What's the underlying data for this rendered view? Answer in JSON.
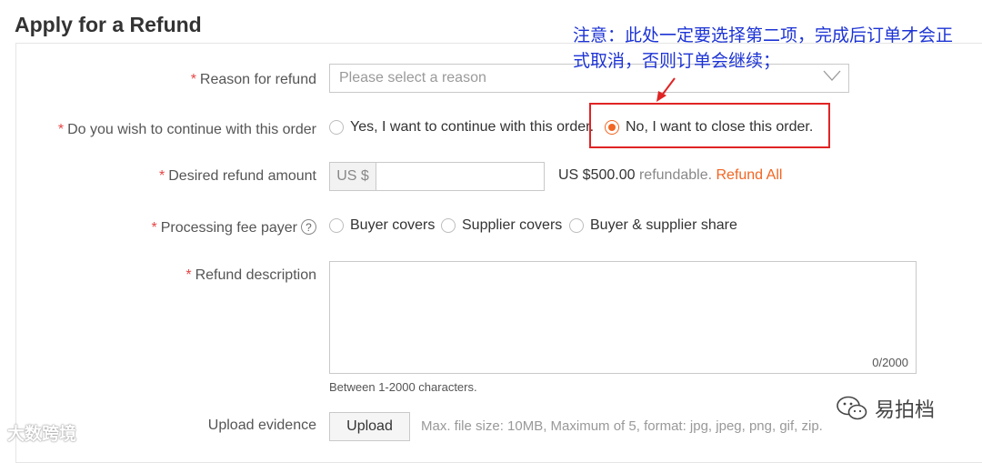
{
  "title": "Apply for a Refund",
  "required_mark": "*",
  "reason": {
    "label": "Reason for refund",
    "placeholder": "Please select a reason"
  },
  "continue_order": {
    "label": "Do you wish to continue with this order",
    "options": [
      {
        "label": "Yes, I want to continue with this order.",
        "selected": false
      },
      {
        "label": "No, I want to close this order.",
        "selected": true
      }
    ]
  },
  "amount": {
    "label": "Desired refund amount",
    "currency_prefix": "US $",
    "value": "",
    "refundable_amount": "US $500.00",
    "refundable_text": "refundable.",
    "refund_all": "Refund All"
  },
  "fee_payer": {
    "label": "Processing fee payer",
    "help_icon": "?",
    "options": [
      {
        "label": "Buyer covers",
        "selected": false
      },
      {
        "label": "Supplier covers",
        "selected": false
      },
      {
        "label": "Buyer & supplier share",
        "selected": false
      }
    ]
  },
  "description": {
    "label": "Refund description",
    "counter": "0/2000",
    "hint": "Between 1-2000 characters."
  },
  "upload": {
    "label": "Upload evidence",
    "button": "Upload",
    "note": "Max. file size: 10MB, Maximum of 5, format: jpg, jpeg, png, gif, zip."
  },
  "annotation": {
    "text": "注意：此处一定要选择第二项，完成后订单才会正式取消，否则订单会继续；",
    "color": "#1c33d4",
    "box_color": "#e02424"
  },
  "watermarks": {
    "left": "大数跨境",
    "right": "易拍档"
  },
  "colors": {
    "accent": "#f26522",
    "required": "#e64545"
  }
}
